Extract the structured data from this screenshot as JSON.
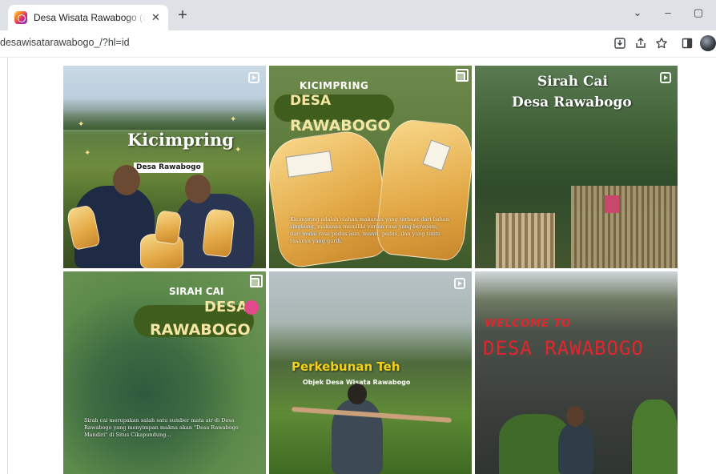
{
  "browser": {
    "tab_title": "Desa Wisata Rawabogo (@desawisatarawabogo_) • Instagram",
    "tab_close": "✕",
    "new_tab": "+",
    "url": "desawisatarawabogo_/?hl=id",
    "window_controls": [
      "⌄",
      "–",
      "▢"
    ]
  },
  "posts": [
    {
      "type": "reel",
      "title": "Kicimpring",
      "label": "Desa Rawabogo"
    },
    {
      "type": "carousel",
      "kicker": "KICIMPRING",
      "title_line1": "DESA",
      "title_line2": "RAWABOGO",
      "caption": "Kicimpring adalah olahan makanan yang terbuat dari bahan singkong, makanan memiliki varian rasa yang beragam, dari mulai rasa pedas asin, manis, pedas, dan yang tentu rasanya yang gurih."
    },
    {
      "type": "reel",
      "title_line1": "Sirah Cai",
      "title_line2": "Desa Rawabogo"
    },
    {
      "type": "carousel",
      "kicker": "SIRAH CAI",
      "title_line1": "DESA",
      "title_line2": "RAWABOGO",
      "caption": "Sirah cai merupakan salah satu sumber mata air di Desa Rawabogo yang menyimpan makna akan \"Desa Rawabogo Mandiri\" di Situs Cikapundung..."
    },
    {
      "type": "reel",
      "title": "Perkebunan Teh",
      "subtitle": "Objek Desa Wisata Rawabogo"
    },
    {
      "type": "image",
      "line1": "WELCOME TO",
      "line2": "DESA RAWABOGO"
    }
  ],
  "colors": {
    "tabstrip": "#dee1e6",
    "brand_green": "#3f5e1e",
    "perkebunan_yellow": "#f4d01c",
    "sign_red": "#e2262b"
  }
}
